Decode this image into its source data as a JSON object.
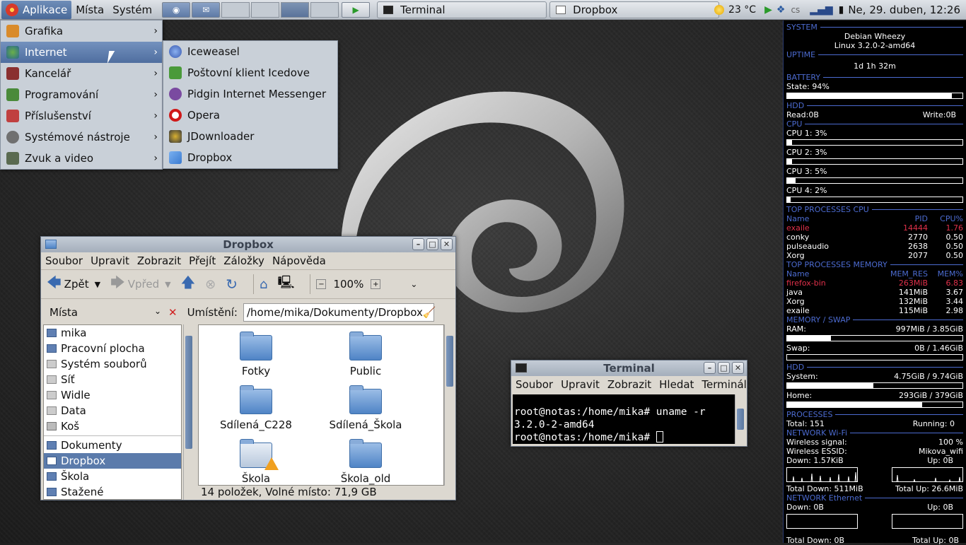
{
  "panel": {
    "apps_label": "Aplikace",
    "places_label": "Místa",
    "system_label": "Systém",
    "tasks": [
      {
        "label": "Terminal"
      },
      {
        "label": "Dropbox"
      }
    ],
    "weather": "23 °C",
    "keyboard_layout": "cs",
    "clock": "Ne, 29. duben, 12:26"
  },
  "appmenu": {
    "items": [
      {
        "label": "Grafika",
        "color": "#d98b2b"
      },
      {
        "label": "Internet",
        "color": "#3c8a3c"
      },
      {
        "label": "Kancelář",
        "color": "#8a3030"
      },
      {
        "label": "Programování",
        "color": "#4a8a3a"
      },
      {
        "label": "Příslušenství",
        "color": "#c04040"
      },
      {
        "label": "Systémové nástroje",
        "color": "#707070"
      },
      {
        "label": "Zvuk a video",
        "color": "#5a6a50"
      }
    ],
    "internet_submenu": [
      {
        "label": "Iceweasel",
        "color": "#3a5ab0"
      },
      {
        "label": "Poštovní klient Icedove",
        "color": "#4a9a3a"
      },
      {
        "label": "Pidgin Internet Messenger",
        "color": "#7a4aa0"
      },
      {
        "label": "Opera",
        "color": "#d01818"
      },
      {
        "label": "JDownloader",
        "color": "#3a3a3a"
      },
      {
        "label": "Dropbox",
        "color": "#3a7ad0"
      }
    ]
  },
  "filemanager": {
    "title": "Dropbox",
    "menus": [
      "Soubor",
      "Upravit",
      "Zobrazit",
      "Přejít",
      "Záložky",
      "Nápověda"
    ],
    "back_label": "Zpět",
    "forward_label": "Vpřed",
    "zoom": "100%",
    "places_label": "Místa",
    "location_label": "Umístění:",
    "location_value": "/home/mika/Dokumenty/Dropbox",
    "sidebar": [
      "mika",
      "Pracovní plocha",
      "Systém souborů",
      "Síť",
      "Widle",
      "Data",
      "Koš",
      "Dokumenty",
      "Dropbox",
      "Škola",
      "Stažené"
    ],
    "folders": [
      "Fotky",
      "Public",
      "Sdílená_C228",
      "Sdílená_Škola",
      "Škola",
      "Škola_old"
    ],
    "status": "14 položek, Volné místo: 71,9 GB"
  },
  "terminal": {
    "title": "Terminal",
    "menus": [
      "Soubor",
      "Upravit",
      "Zobrazit",
      "Hledat",
      "Terminál"
    ],
    "lines": [
      "root@notas:/home/mika# uname -r",
      "3.2.0-2-amd64",
      "root@notas:/home/mika# "
    ]
  },
  "conky": {
    "system_header": "SYSTEM",
    "distro": "Debian Wheezy",
    "kernel": "Linux 3.2.0-2-amd64",
    "uptime_header": "UPTIME",
    "uptime": "1d 1h 32m",
    "battery_header": "BATTERY",
    "battery_state": "State: 94%",
    "battery_level": 0.94,
    "hdd_header": "HDD",
    "hdd_read": "Read:0B",
    "hdd_write": "Write:0B",
    "cpu_header": "CPU",
    "cpus": [
      {
        "label": "CPU 1: 3%",
        "level": 0.03
      },
      {
        "label": "CPU 2: 3%",
        "level": 0.03
      },
      {
        "label": "CPU 3: 5%",
        "level": 0.05
      },
      {
        "label": "CPU 4: 2%",
        "level": 0.02
      }
    ],
    "top_cpu_header": "TOP PROCESSES CPU",
    "top_cpu_cols": [
      "Name",
      "PID",
      "CPU%"
    ],
    "top_cpu": [
      [
        "exaile",
        "14444",
        "1.76"
      ],
      [
        "conky",
        "2770",
        "0.50"
      ],
      [
        "pulseaudio",
        "2638",
        "0.50"
      ],
      [
        "Xorg",
        "2077",
        "0.50"
      ]
    ],
    "top_mem_header": "TOP PROCESSES MEMORY",
    "top_mem_cols": [
      "Name",
      "MEM_RES",
      "MEM%"
    ],
    "top_mem": [
      [
        "firefox-bin",
        "263MiB",
        "6.83"
      ],
      [
        "java",
        "141MiB",
        "3.67"
      ],
      [
        "Xorg",
        "132MiB",
        "3.44"
      ],
      [
        "exaile",
        "115MiB",
        "2.98"
      ]
    ],
    "memswap_header": "MEMORY / SWAP",
    "ram_label": "RAM:",
    "ram_value": "997MiB  / 3.85GiB",
    "ram_level": 0.25,
    "swap_label": "Swap:",
    "swap_value": "0B    / 1.46GiB",
    "swap_level": 0.0,
    "hdd2_header": "HDD",
    "system_disk_label": "System:",
    "system_disk_value": "4.75GiB / 9.74GiB",
    "system_disk_level": 0.49,
    "home_disk_label": "Home:",
    "home_disk_value": "293GiB  / 379GiB",
    "home_disk_level": 0.77,
    "processes_header": "PROCESSES",
    "total_procs": "Total: 151",
    "running_procs": "Running: 0",
    "wifi_header": "NETWORK Wi-Fi",
    "wifi_signal_label": "Wireless signal:",
    "wifi_signal_value": "100  %",
    "wifi_essid_label": "Wireless ESSID:",
    "wifi_essid_value": "Mikova_wifi",
    "wifi_down": "Down: 1.57KiB",
    "wifi_up": "Up: 0B",
    "wifi_total_down": "Total Down: 511MiB",
    "wifi_total_up": "Total Up: 26.6MiB",
    "eth_header": "NETWORK Ethernet",
    "eth_down": "Down: 0B",
    "eth_up": "Up: 0B",
    "eth_total_down": "Total Down: 0B",
    "eth_total_up": "Total Up: 0B"
  }
}
